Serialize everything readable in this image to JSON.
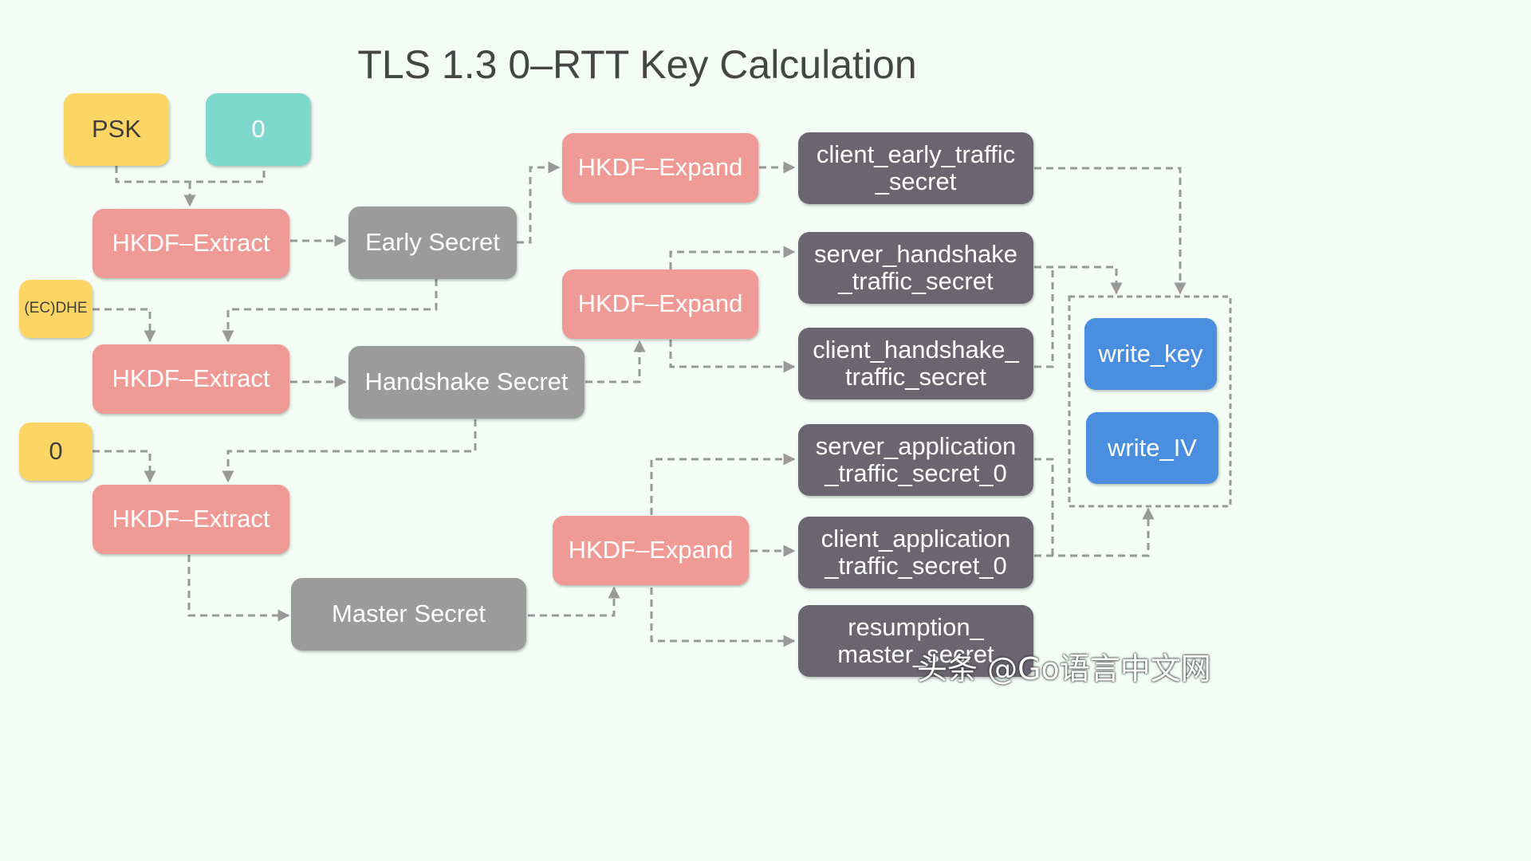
{
  "title": "TLS 1.3 0–RTT Key Calculation",
  "inputs": {
    "psk": "PSK",
    "zero_teal": "0",
    "ecdhe": "(EC)DHE",
    "zero_yellow": "0"
  },
  "functions": {
    "extract_1": "HKDF–Extract",
    "extract_2": "HKDF–Extract",
    "extract_3": "HKDF–Extract",
    "expand_1": "HKDF–Expand",
    "expand_2": "HKDF–Expand",
    "expand_3": "HKDF–Expand"
  },
  "secrets": {
    "early": "Early Secret",
    "handshake": "Handshake Secret",
    "master": "Master Secret"
  },
  "derived": {
    "client_early_traffic_secret": [
      "client_early_traffic",
      "_secret"
    ],
    "server_handshake_traffic_secret": [
      "server_handshake",
      "_traffic_secret"
    ],
    "client_handshake_traffic_secret": [
      "client_handshake_",
      "traffic_secret"
    ],
    "server_application_traffic_secret_0": [
      "server_application",
      "_traffic_secret_0"
    ],
    "client_application_traffic_secret_0": [
      "client_application",
      "_traffic_secret_0"
    ],
    "resumption_master_secret": [
      "resumption_",
      "master_secret"
    ]
  },
  "outputs": {
    "write_key": "write_key",
    "write_iv": "write_IV"
  },
  "watermark": "头条 @Go语言中文网",
  "colors": {
    "input_yellow": "#fcd564",
    "input_teal": "#7dd8cd",
    "function_pink": "#f09a96",
    "secret_gray": "#9b9b9b",
    "derived_dark": "#6a6570",
    "output_blue": "#4a8ee0",
    "connector": "#999999",
    "background": "#f3fdf6"
  }
}
